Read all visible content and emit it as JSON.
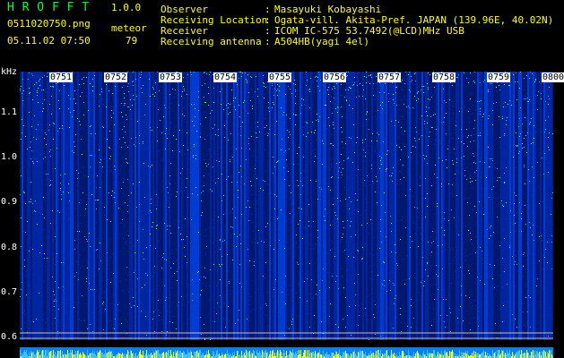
{
  "header": {
    "app_title": "H R O F F T",
    "version": "1.0.0",
    "filename": "0511020750.png",
    "meteor_label": "meteor",
    "meteor_count": "79",
    "timestamp": "05.11.02 07:50"
  },
  "info": [
    {
      "label": "Observer",
      "value": "Masayuki Kobayashi"
    },
    {
      "label": "Receiving Location",
      "value": "Ogata-vill. Akita-Pref. JAPAN (139.96E, 40.02N)"
    },
    {
      "label": "Receiver",
      "value": "ICOM IC-575 53.7492(@LCD)MHz USB"
    },
    {
      "label": "Receiving antenna",
      "value": "A504HB(yagi 4el)"
    }
  ],
  "separator": ":",
  "chart_data": {
    "type": "heatmap",
    "ylabel": "kHz",
    "y_ticks": [
      "1.1",
      "1.0",
      "0.9",
      "0.8",
      "0.7",
      "0.6"
    ],
    "y_tick_values": [
      1.1,
      1.0,
      0.9,
      0.8,
      0.7,
      0.6
    ],
    "x_ticks": [
      "0751",
      "0752",
      "0753",
      "0754",
      "0755",
      "0756",
      "0757",
      "0758",
      "0759",
      "0800"
    ],
    "colors": {
      "background": "#001050",
      "low": "#0030c0",
      "mid": "#00c0ff",
      "high": "#40ff80",
      "peak": "#ffff00"
    }
  }
}
